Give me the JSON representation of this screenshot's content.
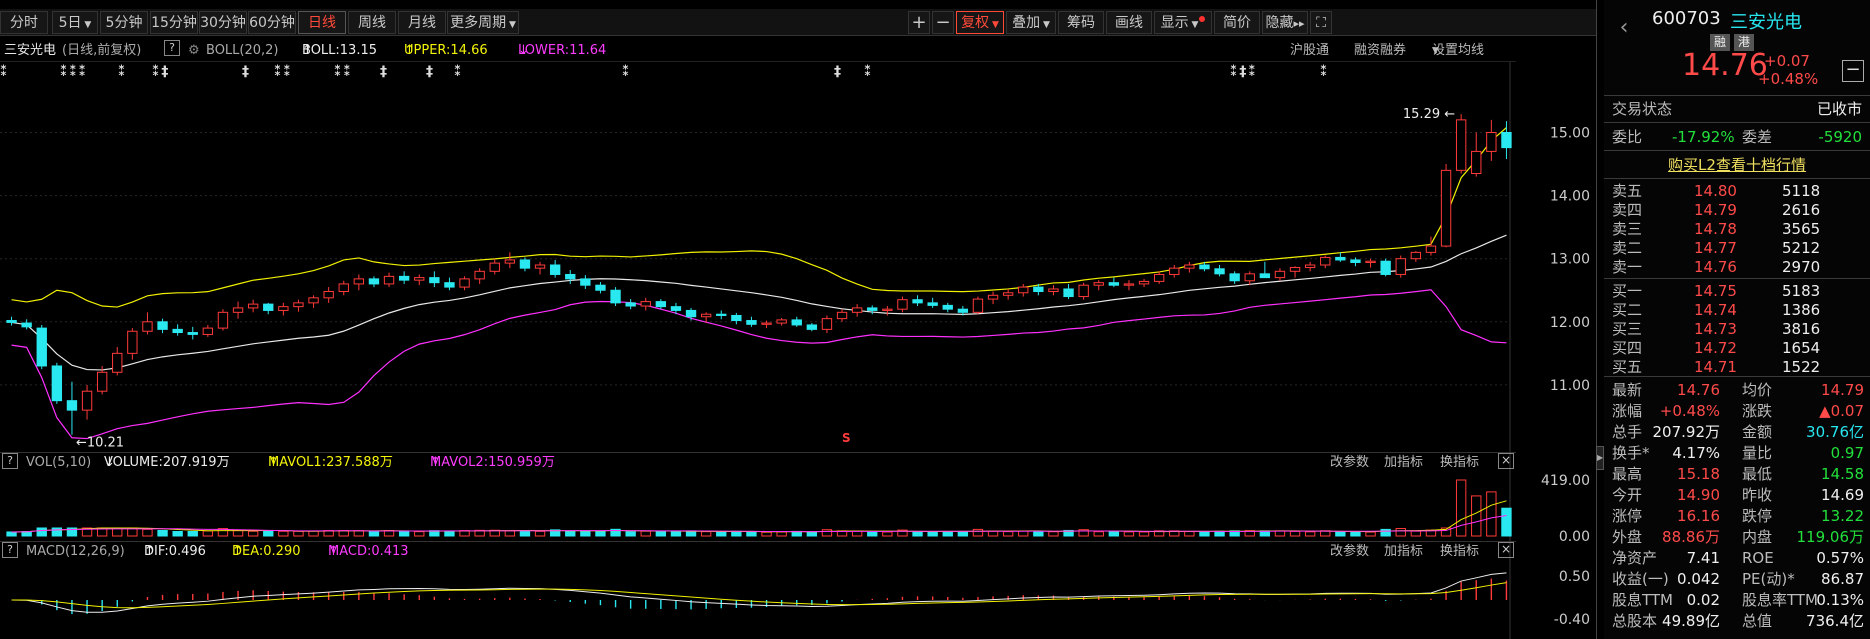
{
  "toolbar": {
    "periods": [
      "分时",
      "5日",
      "5分钟",
      "15分钟",
      "30分钟",
      "60分钟",
      "日线",
      "周线",
      "月线",
      "更多周期"
    ],
    "active_period": "日线",
    "plus": "+",
    "minus": "−",
    "fuquan": "复权",
    "diejia": "叠加",
    "chouma": "筹码",
    "huaxian": "画线",
    "xianshi": "显示",
    "jianjia": "简价",
    "yincang": "隐藏",
    "yincang_arrow": "▸▸",
    "fullscreen": "⛶"
  },
  "infobar": {
    "stock_name": "三安光电",
    "mode": "(日线,前复权)",
    "help": "?",
    "boll_name": "BOLL(20,2)",
    "boll": "BOLL:13.15",
    "upper": "UPPER:14.66",
    "lower": "LOWER:11.64",
    "up_arrow": "↑",
    "down_arrow": "↓",
    "hugutong": "沪股通",
    "rongzi": "融资融券",
    "shezhi": "设置均线"
  },
  "main_chart": {
    "y_ticks": [
      "15.00",
      "14.00",
      "13.00",
      "12.00",
      "11.00"
    ],
    "y_tick_values": [
      15,
      14,
      13,
      12,
      11
    ],
    "high_label": "15.29",
    "low_label": "10.21",
    "high_arrow": "←",
    "low_arrow": "←",
    "s_marker": "S",
    "y_min": 10.0,
    "y_max": 15.8
  },
  "chart_data": {
    "type": "candlestick",
    "ohlc": [
      [
        12.02,
        12.08,
        11.94,
        11.99
      ],
      [
        11.98,
        12.04,
        11.88,
        11.92
      ],
      [
        11.9,
        11.95,
        11.25,
        11.3
      ],
      [
        11.3,
        11.35,
        10.7,
        10.75
      ],
      [
        10.75,
        11.05,
        10.21,
        10.6
      ],
      [
        10.6,
        11.0,
        10.45,
        10.9
      ],
      [
        10.9,
        11.3,
        10.85,
        11.2
      ],
      [
        11.2,
        11.6,
        11.15,
        11.5
      ],
      [
        11.5,
        11.9,
        11.4,
        11.85
      ],
      [
        11.85,
        12.15,
        11.8,
        12.0
      ],
      [
        12.0,
        12.05,
        11.82,
        11.88
      ],
      [
        11.88,
        11.96,
        11.78,
        11.83
      ],
      [
        11.83,
        11.92,
        11.72,
        11.8
      ],
      [
        11.8,
        11.95,
        11.76,
        11.9
      ],
      [
        11.9,
        12.2,
        11.86,
        12.15
      ],
      [
        12.15,
        12.32,
        12.05,
        12.22
      ],
      [
        12.22,
        12.35,
        12.15,
        12.28
      ],
      [
        12.28,
        12.3,
        12.12,
        12.18
      ],
      [
        12.18,
        12.3,
        12.1,
        12.24
      ],
      [
        12.24,
        12.35,
        12.16,
        12.3
      ],
      [
        12.3,
        12.42,
        12.22,
        12.38
      ],
      [
        12.38,
        12.55,
        12.3,
        12.48
      ],
      [
        12.48,
        12.65,
        12.42,
        12.6
      ],
      [
        12.6,
        12.75,
        12.5,
        12.68
      ],
      [
        12.68,
        12.72,
        12.55,
        12.6
      ],
      [
        12.6,
        12.78,
        12.55,
        12.72
      ],
      [
        12.72,
        12.8,
        12.6,
        12.66
      ],
      [
        12.66,
        12.75,
        12.58,
        12.7
      ],
      [
        12.7,
        12.8,
        12.55,
        12.62
      ],
      [
        12.62,
        12.7,
        12.5,
        12.55
      ],
      [
        12.55,
        12.72,
        12.5,
        12.68
      ],
      [
        12.68,
        12.85,
        12.6,
        12.8
      ],
      [
        12.8,
        13.0,
        12.75,
        12.93
      ],
      [
        12.93,
        13.1,
        12.85,
        12.98
      ],
      [
        12.98,
        13.02,
        12.8,
        12.85
      ],
      [
        12.85,
        12.95,
        12.75,
        12.9
      ],
      [
        12.9,
        12.98,
        12.7,
        12.75
      ],
      [
        12.75,
        12.82,
        12.6,
        12.68
      ],
      [
        12.68,
        12.74,
        12.52,
        12.58
      ],
      [
        12.58,
        12.63,
        12.45,
        12.5
      ],
      [
        12.5,
        12.55,
        12.25,
        12.3
      ],
      [
        12.3,
        12.36,
        12.2,
        12.25
      ],
      [
        12.25,
        12.38,
        12.18,
        12.32
      ],
      [
        12.32,
        12.36,
        12.2,
        12.24
      ],
      [
        12.24,
        12.3,
        12.12,
        12.18
      ],
      [
        12.18,
        12.22,
        12.02,
        12.08
      ],
      [
        12.08,
        12.15,
        11.98,
        12.12
      ],
      [
        12.12,
        12.18,
        12.04,
        12.1
      ],
      [
        12.1,
        12.14,
        11.96,
        12.02
      ],
      [
        12.02,
        12.08,
        11.92,
        11.96
      ],
      [
        11.96,
        12.02,
        11.9,
        11.98
      ],
      [
        11.98,
        12.06,
        11.94,
        12.03
      ],
      [
        12.03,
        12.08,
        11.92,
        11.95
      ],
      [
        11.95,
        11.98,
        11.85,
        11.88
      ],
      [
        11.88,
        12.1,
        11.82,
        12.05
      ],
      [
        12.05,
        12.2,
        12.0,
        12.15
      ],
      [
        12.15,
        12.28,
        12.08,
        12.22
      ],
      [
        12.22,
        12.26,
        12.12,
        12.18
      ],
      [
        12.18,
        12.25,
        12.1,
        12.2
      ],
      [
        12.2,
        12.4,
        12.15,
        12.35
      ],
      [
        12.35,
        12.42,
        12.25,
        12.3
      ],
      [
        12.3,
        12.38,
        12.22,
        12.26
      ],
      [
        12.26,
        12.3,
        12.15,
        12.2
      ],
      [
        12.2,
        12.25,
        12.1,
        12.15
      ],
      [
        12.15,
        12.4,
        12.12,
        12.36
      ],
      [
        12.36,
        12.48,
        12.28,
        12.42
      ],
      [
        12.42,
        12.52,
        12.35,
        12.46
      ],
      [
        12.46,
        12.6,
        12.4,
        12.55
      ],
      [
        12.55,
        12.6,
        12.42,
        12.48
      ],
      [
        12.48,
        12.58,
        12.42,
        12.52
      ],
      [
        12.52,
        12.6,
        12.36,
        12.4
      ],
      [
        12.4,
        12.62,
        12.35,
        12.58
      ],
      [
        12.58,
        12.66,
        12.5,
        12.62
      ],
      [
        12.62,
        12.7,
        12.55,
        12.58
      ],
      [
        12.58,
        12.66,
        12.5,
        12.6
      ],
      [
        12.6,
        12.68,
        12.55,
        12.64
      ],
      [
        12.64,
        12.8,
        12.6,
        12.75
      ],
      [
        12.75,
        12.9,
        12.7,
        12.85
      ],
      [
        12.85,
        12.95,
        12.78,
        12.9
      ],
      [
        12.9,
        12.95,
        12.8,
        12.84
      ],
      [
        12.84,
        12.9,
        12.72,
        12.76
      ],
      [
        12.76,
        12.8,
        12.6,
        12.65
      ],
      [
        12.65,
        12.8,
        12.58,
        12.76
      ],
      [
        12.76,
        12.95,
        12.7,
        12.7
      ],
      [
        12.7,
        12.85,
        12.65,
        12.8
      ],
      [
        12.8,
        12.88,
        12.7,
        12.86
      ],
      [
        12.86,
        12.95,
        12.8,
        12.9
      ],
      [
        12.9,
        13.05,
        12.85,
        13.02
      ],
      [
        13.02,
        13.1,
        12.95,
        12.98
      ],
      [
        12.98,
        13.02,
        12.88,
        12.94
      ],
      [
        12.94,
        13.0,
        12.86,
        12.96
      ],
      [
        12.96,
        13.0,
        12.72,
        12.75
      ],
      [
        12.75,
        13.05,
        12.7,
        13.0
      ],
      [
        13.0,
        13.12,
        12.95,
        13.1
      ],
      [
        13.1,
        13.35,
        13.05,
        13.2
      ],
      [
        13.2,
        14.5,
        13.18,
        14.4
      ],
      [
        14.4,
        15.29,
        14.35,
        15.2
      ],
      [
        14.35,
        15.0,
        14.3,
        14.7
      ],
      [
        14.7,
        15.2,
        14.55,
        15.0
      ],
      [
        15.0,
        15.18,
        14.58,
        14.76
      ]
    ],
    "boll": {
      "value": 13.15,
      "upper": 14.66,
      "lower": 11.64
    },
    "volume": {
      "value": "207.919万",
      "mavol1": "237.588万",
      "mavol2": "150.959万",
      "y_ticks": [
        "419.00",
        "0.00"
      ]
    },
    "macd": {
      "dif": 0.496,
      "dea": 0.29,
      "macd": 0.413,
      "y_ticks": [
        "0.50",
        "-0.40"
      ]
    }
  },
  "vol_panel": {
    "help": "?",
    "name": "VOL(5,10)",
    "volume": "VOLUME:207.919万",
    "mavol1": "MAVOL1:237.588万",
    "mavol2": "MAVOL2:150.959万",
    "gaicanshu": "改参数",
    "jiazhibiao": "加指标",
    "huanzhibiao": "换指标",
    "close": "×",
    "y_ticks": [
      "419.00",
      "0.00"
    ]
  },
  "macd_panel": {
    "help": "?",
    "name": "MACD(12,26,9)",
    "dif": "DIF:0.496",
    "dea": "DEA:0.290",
    "macd": "MACD:0.413",
    "gaicanshu": "改参数",
    "jiazhibiao": "加指标",
    "huanzhibiao": "换指标",
    "close": "×",
    "y_ticks": [
      "0.50",
      "-0.40"
    ]
  },
  "side": {
    "code": "600703",
    "name": "三安光电",
    "badge_rong": "融",
    "badge_gang": "港",
    "price": "14.76",
    "change": "+0.07",
    "change_pct": "+0.48%",
    "minus_btn": "−",
    "trade_status_label": "交易状态",
    "trade_status": "已收市",
    "weibi_label": "委比",
    "weibi": "-17.92%",
    "weicha_label": "委差",
    "weicha": "-5920",
    "l2_link": "购买L2查看十档行情",
    "sell": [
      {
        "label": "卖五",
        "price": "14.80",
        "vol": "5118"
      },
      {
        "label": "卖四",
        "price": "14.79",
        "vol": "2616"
      },
      {
        "label": "卖三",
        "price": "14.78",
        "vol": "3565"
      },
      {
        "label": "卖二",
        "price": "14.77",
        "vol": "5212"
      },
      {
        "label": "卖一",
        "price": "14.76",
        "vol": "2970"
      }
    ],
    "buy": [
      {
        "label": "买一",
        "price": "14.75",
        "vol": "5183"
      },
      {
        "label": "买二",
        "price": "14.74",
        "vol": "1386"
      },
      {
        "label": "买三",
        "price": "14.73",
        "vol": "3816"
      },
      {
        "label": "买四",
        "price": "14.72",
        "vol": "1654"
      },
      {
        "label": "买五",
        "price": "14.71",
        "vol": "1522"
      }
    ],
    "stats": [
      {
        "l1": "最新",
        "v1": "14.76",
        "c1": "red",
        "l2": "均价",
        "v2": "14.79",
        "c2": "red"
      },
      {
        "l1": "涨幅",
        "v1": "+0.48%",
        "c1": "red",
        "l2": "涨跌",
        "v2": "▲0.07",
        "c2": "red"
      },
      {
        "l1": "总手",
        "v1": "207.92万",
        "c1": "white",
        "l2": "金额",
        "v2": "30.76亿",
        "c2": "cyan"
      },
      {
        "l1": "换手*",
        "v1": "4.17%",
        "c1": "white",
        "l2": "量比",
        "v2": "0.97",
        "c2": "green"
      },
      {
        "l1": "最高",
        "v1": "15.18",
        "c1": "red",
        "l2": "最低",
        "v2": "14.58",
        "c2": "green"
      },
      {
        "l1": "今开",
        "v1": "14.90",
        "c1": "red",
        "l2": "昨收",
        "v2": "14.69",
        "c2": "white"
      },
      {
        "l1": "涨停",
        "v1": "16.16",
        "c1": "red",
        "l2": "跌停",
        "v2": "13.22",
        "c2": "green"
      },
      {
        "l1": "外盘",
        "v1": "88.86万",
        "c1": "red",
        "l2": "内盘",
        "v2": "119.06万",
        "c2": "green"
      },
      {
        "l1": "净资产",
        "v1": "7.41",
        "c1": "white",
        "l2": "ROE",
        "v2": "0.57%",
        "c2": "white"
      },
      {
        "l1": "收益(一)",
        "v1": "0.042",
        "c1": "white",
        "l2": "PE(动)*",
        "v2": "86.87",
        "c2": "white"
      },
      {
        "l1": "股息TTM",
        "v1": "0.02",
        "c1": "white",
        "l2": "股息率TTM",
        "v2": "0.13%",
        "c2": "white"
      },
      {
        "l1": "总股本",
        "v1": "49.89亿",
        "c1": "white",
        "l2": "总值",
        "v2": "736.4亿",
        "c2": "white"
      }
    ]
  },
  "colors": {
    "up": "#ff3a3a",
    "down": "#2ae8f0",
    "mid": "#e8e8e8",
    "upper": "#f0f000",
    "lower": "#ff30ff",
    "mavol1": "#f0f000",
    "mavol2": "#ff30ff"
  }
}
